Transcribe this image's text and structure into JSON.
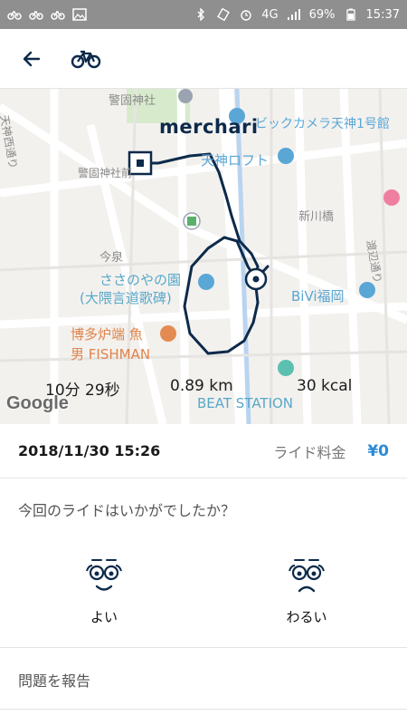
{
  "status_bar": {
    "battery": "69%",
    "time": "15:37",
    "network": "4G"
  },
  "map": {
    "logo": "merchari",
    "attribution": "Google",
    "labels": {
      "keigo_shrine_top": "警固神社",
      "keigo_shrine_front": "警固神社前",
      "bic_camera": "ビックカメラ天神1号館",
      "tenjin_loft": "天神ロフト",
      "imaizumi": "今泉",
      "sasanoyano": "ささのやの園",
      "okuma": "(大隈言道歌碑)",
      "hakata_robata": "博多炉端 魚",
      "fishman": "男 FISHMAN",
      "bivi": "BiVi福岡",
      "shinkawa": "新川橋",
      "tenjin_nishi": "天神西通り",
      "watanabe": "渡辺通り",
      "beat_station": "BEAT STATION"
    }
  },
  "stats": {
    "duration": "10分 29秒",
    "distance": "0.89 km",
    "calories": "30 kcal"
  },
  "ride": {
    "datetime": "2018/11/30 15:26",
    "fee_label": "ライド料金",
    "fee_value": "¥0"
  },
  "feedback": {
    "question": "今回のライドはいかがでしたか？",
    "good_label": "よい",
    "bad_label": "わるい"
  },
  "report_label": "問題を報告",
  "colors": {
    "accent": "#2b8bd6",
    "navy": "#0d2a4a",
    "status_bar": "#8f8f8f"
  }
}
